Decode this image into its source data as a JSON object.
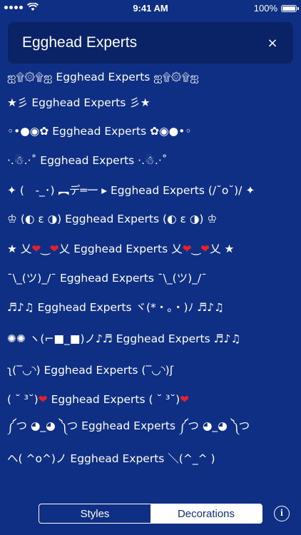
{
  "status_bar": {
    "time": "9:41 AM",
    "battery": "100%"
  },
  "search": {
    "value": "Egghead Experts",
    "clear_label": "×"
  },
  "results": [
    {
      "text": "ஐ۩۞۩ஐ Egghead Experts ஐ۩۞۩ஐ"
    },
    {
      "text": "★彡 Egghead Experts 彡★"
    },
    {
      "text": "◦•●◉✿ Egghead Experts ✿◉●•◦"
    },
    {
      "text": "·.☃.·˚ Egghead Experts ·.☃.·˚"
    },
    {
      "text": "✦ (　-_･) ︻デ═一 ▸ Egghead Experts (/˘o˘)/ ✦"
    },
    {
      "text": "♔ (◐ ε ◑) Egghead Experts (◐ ε ◑) ♔"
    },
    {
      "text": "★ 乂❤‿❤乂 Egghead Experts 乂❤‿❤乂 ★"
    },
    {
      "text": "¯\\_(ツ)_/¯ Egghead Experts ¯\\_(ツ)_/¯"
    },
    {
      "text": "♬♪♫ Egghead Experts ヾ(*・。・)ﾉ ♬♪♫"
    },
    {
      "text": "✺✺ ヽ(⌐■_■)ノ♪♬ Egghead Experts ♬♪♫"
    },
    {
      "text": "ʅ(‾◡◝) Egghead Experts (‾◡◝)ʃ"
    },
    {
      "text": "( ˘ ³˘)❤ Egghead Experts ( ˘ ³˘)❤"
    },
    {
      "text": "༼つ ◕_◕ ༽つ Egghead Experts ༼つ ◕_◕ ༽つ"
    },
    {
      "text": "ヘ( ^o^)ノ Egghead Experts ＼(^_^ )"
    }
  ],
  "tabs": {
    "styles": "Styles",
    "decorations": "Decorations",
    "active": "decorations"
  },
  "info_label": "i",
  "colors": {
    "background": "#0e2f83",
    "search_background": "#0a2367",
    "heart": "#e8202a"
  }
}
